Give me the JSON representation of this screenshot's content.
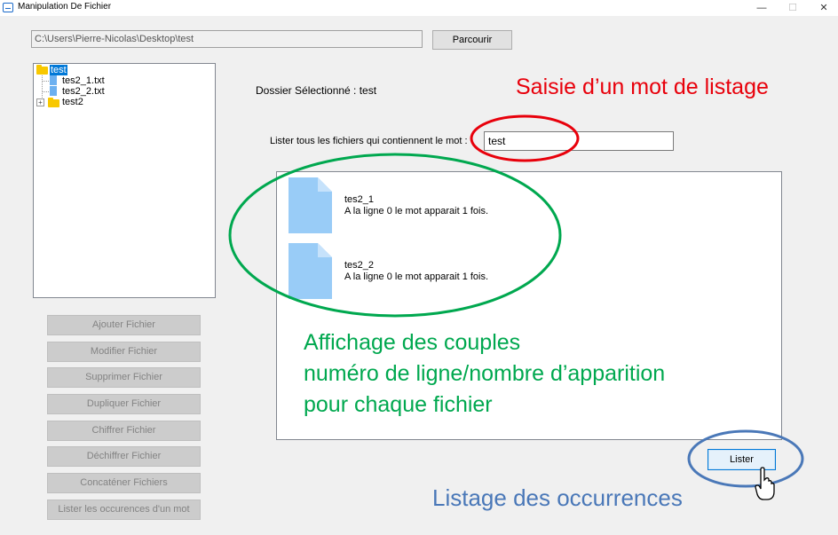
{
  "window": {
    "title": "Manipulation De Fichier",
    "minimize": "—",
    "maximize": "☐",
    "close": "✕"
  },
  "path": {
    "value": "C:\\Users\\Pierre-Nicolas\\Desktop\\test",
    "browse_label": "Parcourir"
  },
  "tree": {
    "root": "test",
    "children": [
      {
        "label": "tes2_1.txt",
        "type": "file"
      },
      {
        "label": "tes2_2.txt",
        "type": "file"
      },
      {
        "label": "test2",
        "type": "folder",
        "expandable": true
      }
    ]
  },
  "actions": [
    "Ajouter Fichier",
    "Modifier Fichier",
    "Supprimer Fichier",
    "Dupliquer Fichier",
    "Chiffrer Fichier",
    "Déchiffrer Fichier",
    "Concaténer Fichiers",
    "Lister les occurences d'un mot"
  ],
  "selected_folder": "Dossier Sélectionné : test",
  "search": {
    "label": "Lister tous les fichiers qui contiennent le mot :",
    "value": "test"
  },
  "results": [
    {
      "name": "tes2_1",
      "line": "A la ligne 0 le mot apparait 1 fois."
    },
    {
      "name": "tes2_2",
      "line": "A la ligne 0 le mot apparait 1 fois."
    }
  ],
  "list_button": "Lister",
  "annotations": {
    "input_note": "Saisie d’un mot de listage",
    "results_note": [
      "Affichage des couples",
      "numéro de ligne/nombre d’apparition",
      "pour chaque fichier"
    ],
    "list_note": "Listage des occurrences"
  },
  "colors": {
    "red": "#e8000b",
    "green": "#00a84f",
    "blue": "#4a78b8",
    "selection": "#0078d7"
  }
}
